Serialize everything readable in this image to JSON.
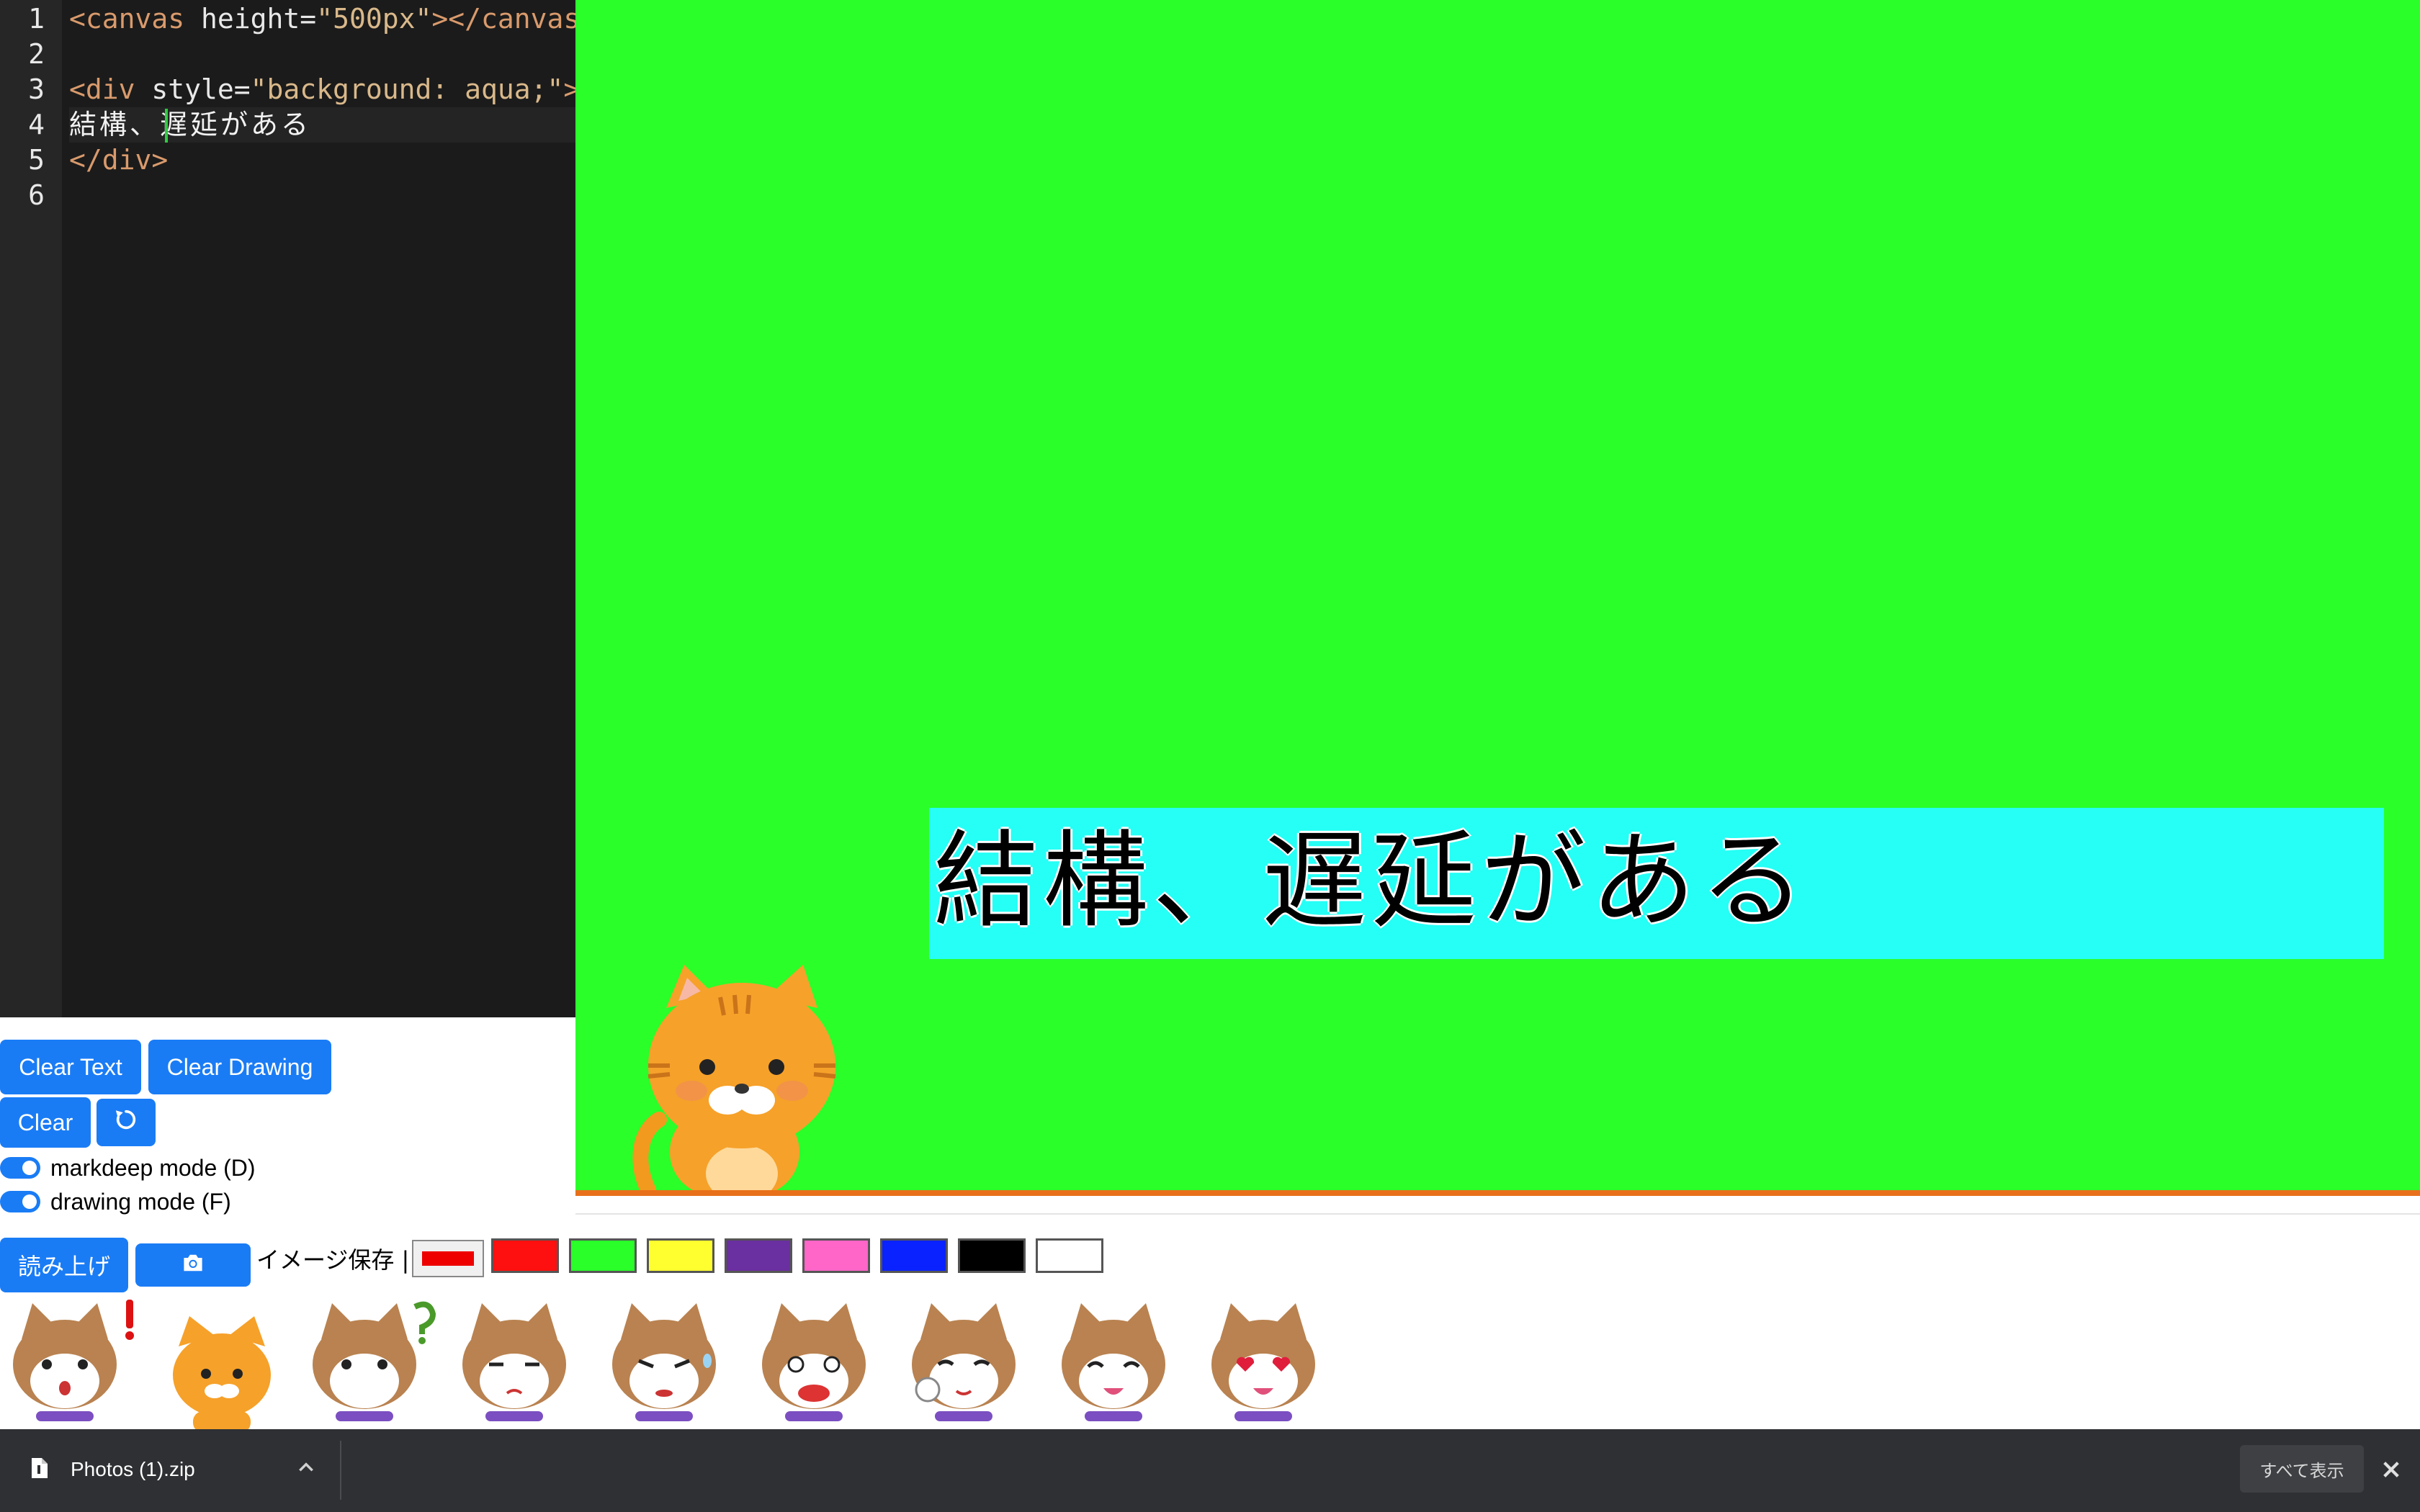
{
  "editor": {
    "line_numbers": [
      "1",
      "2",
      "3",
      "4",
      "5",
      "6"
    ],
    "lines": {
      "l1_tag_open": "<canvas",
      "l1_attr": " height=",
      "l1_str": "\"500px\"",
      "l1_tag_close": "></canvas>",
      "l3_tag_open": "<div",
      "l3_attr": " style=",
      "l3_str": "\"background: aqua;\"",
      "l3_tag_close": ">",
      "l4_text": "結構、遅延がある",
      "l5_tag": "</div>"
    }
  },
  "stage": {
    "background": "#2aff2a",
    "caption_background": "#25fff5",
    "caption_text": "結構、遅延がある"
  },
  "controls": {
    "clear_text": "Clear Text",
    "clear_drawing": "Clear Drawing",
    "clear": "Clear",
    "undo_icon": "undo-icon",
    "markdeep_label": "markdeep mode (D)",
    "drawing_label": "drawing mode (F)",
    "read_aloud": "読み上げ",
    "camera_icon": "camera-icon",
    "image_save_label": "イメージ保存 |"
  },
  "palette": {
    "current": "#e00000",
    "colors": [
      "#ff1010",
      "#2aff2a",
      "#ffff30",
      "#6a2fa0",
      "#ff66c8",
      "#0a22ff",
      "#000000",
      "#ffffff"
    ]
  },
  "stickers": [
    "exclamation-cat",
    "orange-cat",
    "question-cat",
    "sad-cat",
    "sweat-cat",
    "shocked-cat",
    "wink-cat",
    "happy-cat",
    "heart-eyes-cat"
  ],
  "download_bar": {
    "file_name": "Photos (1).zip",
    "show_all": "すべて表示"
  }
}
